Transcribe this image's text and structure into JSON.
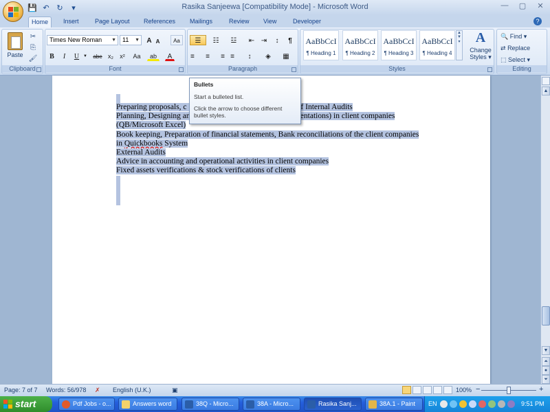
{
  "window": {
    "title": "Rasika Sanjeewa [Compatibility Mode] - Microsoft Word",
    "controls": [
      "—",
      "▢",
      "✕"
    ]
  },
  "qat": {
    "save": "💾",
    "undo": "↶",
    "redo": "↻",
    "more": "▾"
  },
  "tabs": [
    "Home",
    "Insert",
    "Page Layout",
    "References",
    "Mailings",
    "Review",
    "View",
    "Developer"
  ],
  "active_tab": "Home",
  "help": "?",
  "groups": {
    "clipboard": "Clipboard",
    "font": "Font",
    "paragraph": "Paragraph",
    "styles": "Styles",
    "editing": "Editing"
  },
  "clipboard": {
    "paste_label": "Paste",
    "cut": "✂",
    "copy": "⎘",
    "format_painter": "🖌"
  },
  "font": {
    "name": "Times New Roman",
    "size": "11",
    "grow": "A",
    "shrink": "A",
    "clear": "Aa",
    "bold": "B",
    "italic": "I",
    "underline": "U",
    "strikethrough": "abe",
    "subscript": "x₂",
    "superscript": "x²",
    "change_case": "Aa",
    "highlight": "ab",
    "font_color": "A"
  },
  "paragraph": {
    "bullets": "☰",
    "numbering": "☷",
    "multilevel": "☳",
    "decrease_indent": "⇤",
    "increase_indent": "⇥",
    "sort": "↕",
    "show_marks": "¶",
    "align_left": "≡",
    "center": "≡",
    "align_right": "≡",
    "justify": "≡",
    "line_spacing": "↕",
    "shading": "◈",
    "borders": "▦"
  },
  "styles": {
    "tiles": [
      {
        "sample": "AaBbCcI",
        "name": "¶ Heading 1"
      },
      {
        "sample": "AaBbCcI",
        "name": "¶ Heading 2"
      },
      {
        "sample": "AaBbCcI",
        "name": "¶ Heading 3"
      },
      {
        "sample": "AaBbCcI",
        "name": "¶ Heading 4"
      }
    ],
    "change_styles_icon": "A",
    "change_styles_line1": "Change",
    "change_styles_line2": "Styles ▾"
  },
  "editing": {
    "find": "Find ▾",
    "replace": "Replace",
    "select": "Select ▾"
  },
  "tooltip": {
    "title": "Bullets",
    "line1": "Start a bulleted list.",
    "line2": "Click the arrow to choose different bullet styles."
  },
  "document": {
    "lines": [
      {
        "before": "Preparing proposals, c",
        "after": "orts of Internal Audits"
      },
      {
        "before": "Planning, Designing an",
        "after": "implementations) in client companies"
      },
      {
        "before": "(QB/Microsoft Excel)",
        "after": ""
      },
      {
        "before": "Book keeping, Preparation of financial statements, Bank reconciliations of the client companies",
        "after": ""
      },
      {
        "before": "in ",
        "misspelled": "Quickbooks",
        "after": " System"
      },
      {
        "before": "External Audits",
        "after": ""
      },
      {
        "before": "Advice in accounting and operational activities in client companies",
        "after": ""
      },
      {
        "before": "Fixed assets verifications & stock verifications of clients",
        "after": ""
      }
    ]
  },
  "statusbar": {
    "page": "Page: 7 of 7",
    "words": "Words: 56/978",
    "language": "English (U.K.)",
    "zoom": "100%",
    "zoom_minus": "−",
    "zoom_plus": "+"
  },
  "taskbar": {
    "start": "start",
    "buttons": [
      "Pdf Jobs - o...",
      "Answers word",
      "38Q - Micro...",
      "38A - Micro...",
      "Rasika Sanj...",
      "38A.1 - Paint"
    ],
    "active_button": "Rasika Sanj...",
    "lang": "EN",
    "clock": "9:51 PM"
  }
}
